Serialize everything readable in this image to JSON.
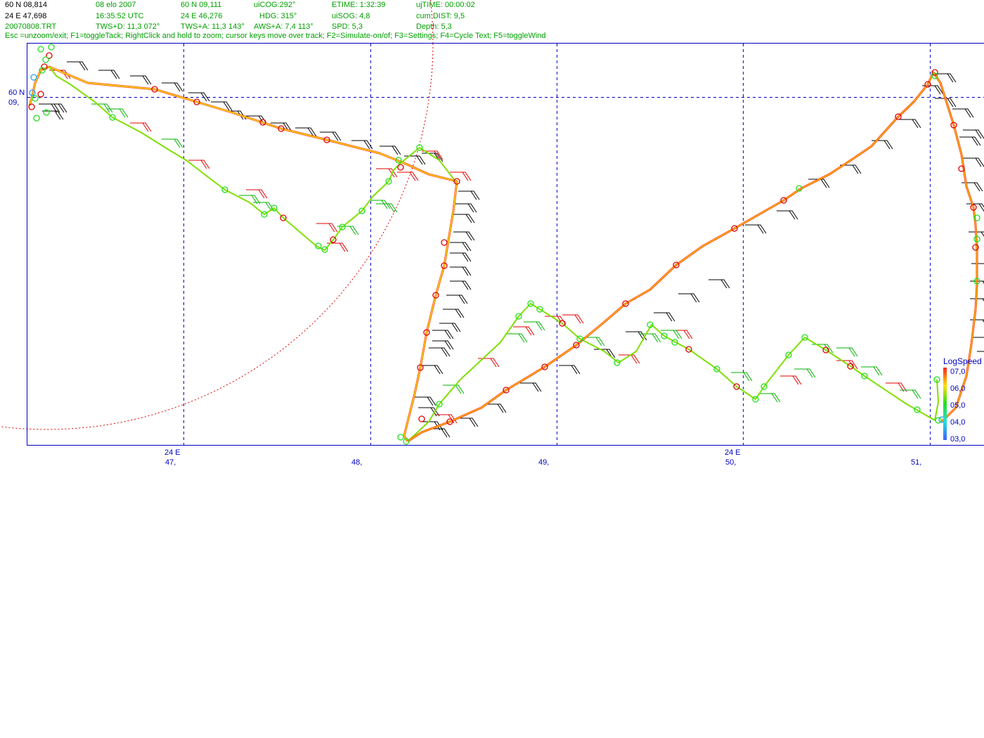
{
  "header": {
    "row1": {
      "lat": "60 N 08,814",
      "date": "08 elo 2007",
      "cursor_lat": "60 N 09,111",
      "uicog": "uiCOG:292°",
      "etime": "ETIME: 1:32:39",
      "ujtime": "ujTIME: 00:00:02"
    },
    "row2": {
      "lon": "24 E 47,698",
      "time": "16:35:52  UTC",
      "cursor_lon": "24 E 46,276",
      "hdg": "HDG: 315°",
      "uisog": "uiSOG: 4,8",
      "cum_dist": "cum DIST: 9,5"
    },
    "row3": {
      "file": "20070808.TRT",
      "tws_d": "TWS+D: 11,3 072°",
      "tws_a": "TWS+A: 11,3 143°",
      "aws_a": "AWS+A: 7,4 113°",
      "spd": "SPD: 5,3",
      "depth": "Depth: 5,3"
    },
    "help": "Esc =unzoom/exit; F1=toggleTack; RightClick and hold to zoom; cursor keys move over track; F2=Simulate-on/of; F3=Settings; F4=Cycle Text; F5=toggleWind"
  },
  "axes": {
    "y_label_deg": "60 N",
    "y_label_min": "09,",
    "x_ticks": [
      {
        "deg": "24 E",
        "min": "47,"
      },
      {
        "deg": "",
        "min": "48,"
      },
      {
        "deg": "",
        "min": "49,"
      },
      {
        "deg": "24 E",
        "min": "50,"
      },
      {
        "deg": "",
        "min": "51,"
      }
    ]
  },
  "legend": {
    "title": "LogSpeed",
    "items": [
      "07,0",
      "06,0",
      "05,0",
      "04,0",
      "03,0"
    ]
  },
  "colors": {
    "frame": "#0000c0",
    "grid": "#0000c0",
    "track_mid": "#80e000",
    "track_fast": "#ff4000",
    "marker_fast": "#e00000",
    "marker_mid": "#20e020",
    "marker_slow": "#20a0ff",
    "wind_true": "#000000",
    "wind_port": "#e00000",
    "wind_stbd": "#00b000",
    "arc": "#e00000"
  }
}
